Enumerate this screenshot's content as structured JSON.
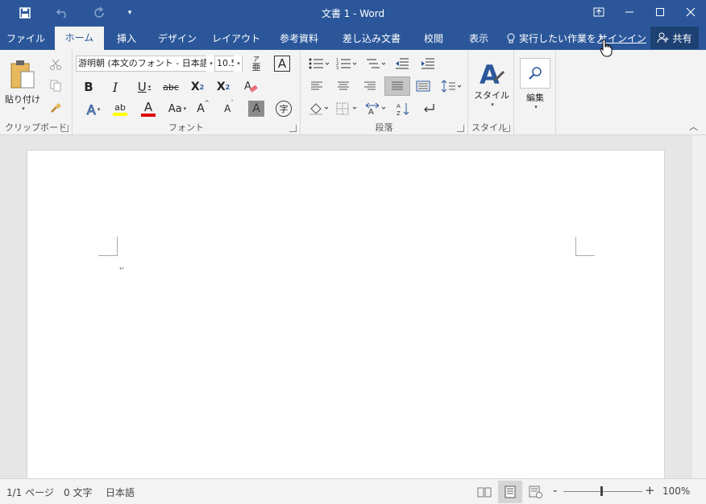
{
  "title": "文書 1 - Word",
  "qat": {
    "save": "save-icon",
    "undo": "undo-icon",
    "redo": "redo-icon",
    "customize": "▾"
  },
  "window_controls": [
    "ribbon-display-options-icon",
    "minimize-icon",
    "maximize-icon",
    "close-icon"
  ],
  "tabs": [
    {
      "label": "ファイル"
    },
    {
      "label": "ホーム"
    },
    {
      "label": "挿入"
    },
    {
      "label": "デザイン"
    },
    {
      "label": "レイアウト"
    },
    {
      "label": "参考資料"
    },
    {
      "label": "差し込み文書"
    },
    {
      "label": "校閲"
    },
    {
      "label": "表示"
    }
  ],
  "tell_me": "実行したい作業を入",
  "sign_in": "サインイン",
  "share": "共有",
  "ribbon": {
    "clipboard": {
      "paste_label": "貼り付け",
      "group_label": "クリップボード"
    },
    "font": {
      "font_name": "游明朝 (本文のフォント - 日本語",
      "font_size": "10.5",
      "phonetic_top": "ア",
      "phonetic_bottom": "亜",
      "char_border": "A",
      "bold": "B",
      "italic": "I",
      "underline": "U",
      "strike": "abc",
      "subscript": "X",
      "subscript_sub": "2",
      "superscript": "X",
      "superscript_sup": "2",
      "text_effects": "A",
      "highlight": "ab",
      "font_color": "A",
      "change_case": "Aa",
      "grow": "A",
      "shrink": "A",
      "shading": "A",
      "enclose": "字",
      "group_label": "フォント"
    },
    "paragraph": {
      "group_label": "段落"
    },
    "styles": {
      "label": "スタイル",
      "group_label": "スタイル"
    },
    "editing": {
      "label": "編集"
    }
  },
  "status": {
    "page": "1/1 ページ",
    "words": "0 文字",
    "language": "日本語",
    "zoom_minus": "-",
    "zoom_plus": "+",
    "zoom": "100%"
  },
  "zoom_level": 100,
  "colors": {
    "accent": "#2b579a",
    "highlight": "#ffff00",
    "font_color": "#e00000"
  }
}
